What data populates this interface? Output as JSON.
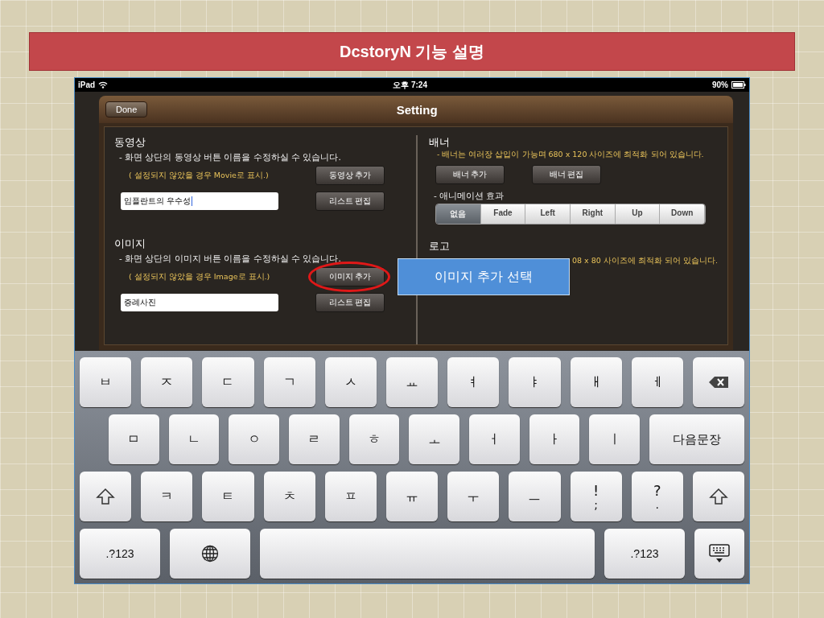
{
  "slide": {
    "title": "DcstoryN 기능 설명"
  },
  "status_bar": {
    "device": "iPad",
    "time": "오후 7:24",
    "battery": "90%"
  },
  "dialog": {
    "title": "Setting",
    "done_button": "Done",
    "left_sections": [
      {
        "heading": "동영상",
        "description": "- 화면 상단의 동영상 버튼 이름을 수정하실 수 있습니다.",
        "note": "( 설정되지 않았을 경우 Movie로 표시.)",
        "field_value": "임플란트의 우수성",
        "focused": true,
        "buttons": [
          {
            "label": "동영상 추가",
            "circled": false
          },
          {
            "label": "리스트 편집",
            "circled": false
          }
        ]
      },
      {
        "heading": "이미지",
        "description": "- 화면 상단의 이미지 버튼 이름을 수정하실 수 있습니다.",
        "note": "( 설정되지 않았을 경우 Image로 표시.)",
        "field_value": "증례사진",
        "focused": false,
        "buttons": [
          {
            "label": "이미지 추가",
            "circled": true
          },
          {
            "label": "리스트 편집",
            "circled": false
          }
        ]
      }
    ],
    "banner": {
      "heading": "배너",
      "description": "- 배너는 여러장 삽입이 가능며 680 x 120 사이즈에 최적화 되어 있습니다.",
      "buttons": [
        "배너 추가",
        "배너 편집"
      ],
      "animation_label": "- 애니메이션 효과",
      "segments": [
        {
          "label": "없음",
          "selected": true
        },
        {
          "label": "Fade",
          "selected": false
        },
        {
          "label": "Left",
          "selected": false
        },
        {
          "label": "Right",
          "selected": false
        },
        {
          "label": "Up",
          "selected": false
        },
        {
          "label": "Down",
          "selected": false
        }
      ]
    },
    "logo": {
      "heading": "로고",
      "description": "08 x 80 사이즈에 최적화 되어 있습니다."
    }
  },
  "callout": {
    "text": "이미지 추가 선택"
  },
  "keyboard": {
    "row_1": [
      {
        "kind": "char",
        "label": "ㅂ"
      },
      {
        "kind": "char",
        "label": "ㅈ"
      },
      {
        "kind": "char",
        "label": "ㄷ"
      },
      {
        "kind": "char",
        "label": "ㄱ"
      },
      {
        "kind": "char",
        "label": "ㅅ"
      },
      {
        "kind": "char",
        "label": "ㅛ"
      },
      {
        "kind": "char",
        "label": "ㅕ"
      },
      {
        "kind": "char",
        "label": "ㅑ"
      },
      {
        "kind": "char",
        "label": "ㅐ"
      },
      {
        "kind": "char",
        "label": "ㅔ"
      },
      {
        "kind": "backspace"
      }
    ],
    "row_2": [
      {
        "kind": "char",
        "label": "ㅁ"
      },
      {
        "kind": "char",
        "label": "ㄴ"
      },
      {
        "kind": "char",
        "label": "ㅇ"
      },
      {
        "kind": "char",
        "label": "ㄹ"
      },
      {
        "kind": "char",
        "label": "ㅎ"
      },
      {
        "kind": "char",
        "label": "ㅗ"
      },
      {
        "kind": "char",
        "label": "ㅓ"
      },
      {
        "kind": "char",
        "label": "ㅏ"
      },
      {
        "kind": "char",
        "label": "ㅣ"
      },
      {
        "kind": "return",
        "label": "다음문장"
      }
    ],
    "row_3": [
      {
        "kind": "shift"
      },
      {
        "kind": "char",
        "label": "ㅋ"
      },
      {
        "kind": "char",
        "label": "ㅌ"
      },
      {
        "kind": "char",
        "label": "ㅊ"
      },
      {
        "kind": "char",
        "label": "ㅍ"
      },
      {
        "kind": "char",
        "label": "ㅠ"
      },
      {
        "kind": "char",
        "label": "ㅜ"
      },
      {
        "kind": "char",
        "label": "ㅡ"
      },
      {
        "kind": "dual",
        "label": "!",
        "sub": ";"
      },
      {
        "kind": "dual",
        "label": "?",
        "sub": "."
      },
      {
        "kind": "shift"
      }
    ],
    "bottom_row": [
      {
        "kind": "mode",
        "label": ".?123"
      },
      {
        "kind": "globe"
      },
      {
        "kind": "space"
      },
      {
        "kind": "mode",
        "label": ".?123"
      },
      {
        "kind": "hide"
      }
    ]
  }
}
